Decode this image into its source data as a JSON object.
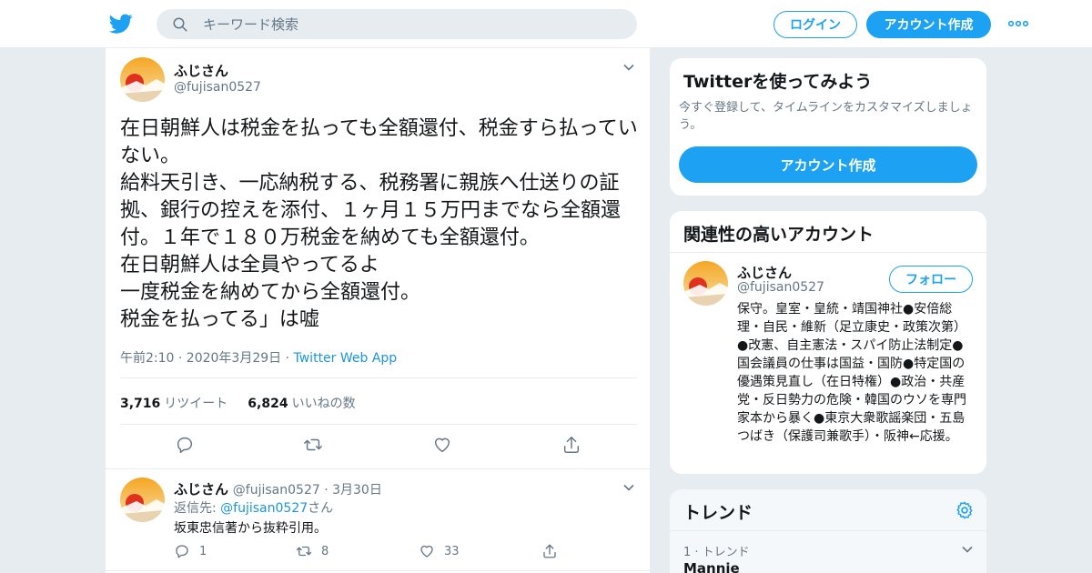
{
  "topbar": {
    "search_placeholder": "キーワード検索",
    "login_label": "ログイン",
    "signup_label": "アカウント作成",
    "brand_color": "#1da1f2"
  },
  "tweet": {
    "name": "ふじさん",
    "handle": "@fujisan0527",
    "text": "在日朝鮮人は税金を払っても全額還付、税金すら払っていない。\n給料天引き、一応納税する、税務署に親族へ仕送りの証拠、銀行の控えを添付、１ヶ月１５万円までなら全額還付。１年で１８０万税金を納めても全額還付。\n在日朝鮮人は全員やってるよ\n一度税金を納めてから全額還付。\n税金を払ってる」は嘘",
    "time": "午前2:10 · 2020年3月29日 · ",
    "app": "Twitter Web App",
    "retweets": "3,716",
    "retweets_label": "リツイート",
    "likes": "6,824",
    "likes_label": "いいねの数"
  },
  "reply": {
    "name": "ふじさん",
    "handle_date": "@fujisan0527 · 3月30日",
    "reply_to_prefix": "返信先: ",
    "reply_to_link": "@fujisan0527",
    "reply_to_suffix": "さん",
    "text": "坂東忠信著から抜粋引用。",
    "replies": "1",
    "retweets": "8",
    "likes": "33"
  },
  "sidebar": {
    "signup_card": {
      "title": "Twitterを使ってみよう",
      "description": "今すぐ登録して、タイムラインをカスタマイズしましょう。",
      "button": "アカウント作成"
    },
    "related": {
      "title": "関連性の高いアカウント",
      "name": "ふじさん",
      "handle": "@fujisan0527",
      "follow_label": "フォロー",
      "bio": "保守。皇室・皇統・靖国神社●安倍総理・自民・維新（足立康史・政策次第）●改憲、自主憲法・スパイ防止法制定●国会議員の仕事は国益・国防●特定国の優遇策見直し（在日特権）●政治・共産党・反日勢力の危険・韓国のウソを専門家本から暴く●東京大衆歌謡楽団・五島つばき（保護司兼歌手）・阪神←応援。"
    },
    "trends": {
      "title": "トレンド",
      "rank_label": "1 · トレンド",
      "name": "Mannie"
    }
  }
}
